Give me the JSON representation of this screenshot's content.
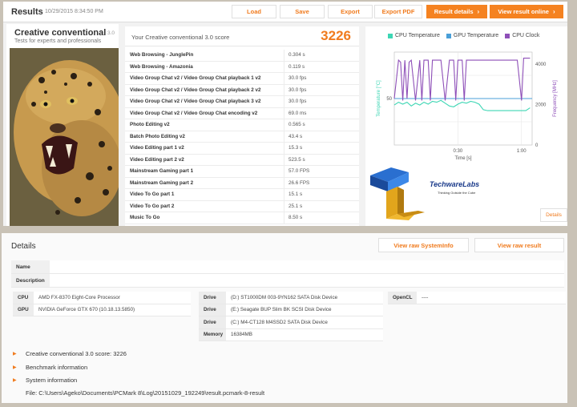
{
  "header": {
    "title": "Results",
    "date": "10/29/2015 8:34:50 PM",
    "buttons": {
      "load": "Load",
      "save": "Save",
      "export": "Export",
      "export_pdf": "Export PDF",
      "result_details": "Result details",
      "view_online": "View result online"
    }
  },
  "test": {
    "name": "Creative conventional",
    "version": "3.0",
    "subtitle": "Tests for experts and professionals"
  },
  "score": {
    "label": "Your Creative conventional 3.0 score",
    "value": "3226",
    "rows": [
      {
        "name": "Web Browsing - JunglePin",
        "value": "0.304 s"
      },
      {
        "name": "Web Browsing - Amazonia",
        "value": "0.119 s"
      },
      {
        "name": "Video Group Chat v2 / Video Group Chat playback 1 v2",
        "value": "30.0 fps"
      },
      {
        "name": "Video Group Chat v2 / Video Group Chat playback 2 v2",
        "value": "30.0 fps"
      },
      {
        "name": "Video Group Chat v2 / Video Group Chat playback 3 v2",
        "value": "30.0 fps"
      },
      {
        "name": "Video Group Chat v2 / Video Group Chat encoding v2",
        "value": "69.0 ms"
      },
      {
        "name": "Photo Editing v2",
        "value": "0.565 s"
      },
      {
        "name": "Batch Photo Editing v2",
        "value": "43.4 s"
      },
      {
        "name": "Video Editing part 1 v2",
        "value": "15.3 s"
      },
      {
        "name": "Video Editing part 2 v2",
        "value": "523.5 s"
      },
      {
        "name": "Mainstream Gaming part 1",
        "value": "57.0 FPS"
      },
      {
        "name": "Mainstream Gaming part 2",
        "value": "26.6 FPS"
      },
      {
        "name": "Video To Go part 1",
        "value": "15.1 s"
      },
      {
        "name": "Video To Go part 2",
        "value": "25.1 s"
      },
      {
        "name": "Music To Go",
        "value": "8.50 s"
      }
    ]
  },
  "chart_data": {
    "type": "line",
    "legend": [
      "CPU Temperature",
      "GPU Temperature",
      "CPU Clock"
    ],
    "colors": {
      "cpu_temp": "#3dd6b4",
      "gpu_temp": "#4a9fd8",
      "cpu_clock": "#8e4fb8"
    },
    "ylabel_left": "Temperature [°C]",
    "ylabel_right": "Frequency [MHz]",
    "xlabel": "Time [s]",
    "x_ticks": [
      "0:30",
      "1:00"
    ],
    "y_left_ticks": [
      "50"
    ],
    "y_right_ticks": [
      "4000",
      "2000",
      "0"
    ],
    "x_range": [
      0,
      65
    ],
    "y_left_range": [
      0,
      100
    ],
    "y_right_range": [
      0,
      4600
    ],
    "series": [
      {
        "name": "CPU Temperature",
        "axis": "left",
        "x": [
          0,
          2,
          4,
          6,
          8,
          10,
          12,
          14,
          16,
          18,
          20,
          22,
          24,
          26,
          28,
          30,
          32,
          34,
          36,
          38,
          40,
          42,
          44,
          46,
          48,
          50,
          52,
          54,
          56,
          58,
          60,
          62,
          64
        ],
        "y": [
          43,
          46,
          44,
          46,
          42,
          45,
          43,
          46,
          44,
          47,
          46,
          48,
          45,
          42,
          41,
          44,
          46,
          45,
          47,
          46,
          44,
          38,
          37,
          37,
          37,
          37,
          37,
          37,
          37,
          37,
          37,
          37,
          40
        ]
      },
      {
        "name": "GPU Temperature",
        "axis": "left",
        "x": [
          0,
          65
        ],
        "y": [
          50,
          50
        ]
      },
      {
        "name": "CPU Clock",
        "axis": "right",
        "x": [
          0,
          2,
          3,
          4,
          5,
          6,
          7,
          8,
          10,
          12,
          13,
          14,
          16,
          17,
          18,
          20,
          22,
          24,
          26,
          28,
          29,
          30,
          32,
          33,
          34,
          36,
          38,
          40,
          42,
          44,
          46,
          48,
          50,
          52,
          54,
          56,
          58,
          60,
          61,
          62,
          64
        ],
        "y": [
          2300,
          4200,
          4100,
          2200,
          4200,
          2300,
          4100,
          4200,
          2200,
          4200,
          2200,
          4200,
          4200,
          2200,
          4200,
          4200,
          4200,
          2200,
          4200,
          4200,
          2200,
          4200,
          4200,
          2200,
          4200,
          4200,
          4200,
          4200,
          4200,
          4200,
          4200,
          4200,
          4200,
          4200,
          4200,
          4200,
          4200,
          2200,
          4300,
          4300,
          4300
        ]
      }
    ]
  },
  "logo": {
    "brand": "TechwareLabs",
    "tagline": "Thinking Outside the Cube"
  },
  "chart_details_button": "Details",
  "details": {
    "title": "Details",
    "raw_systeminfo": "View raw SystemInfo",
    "raw_result": "View raw result",
    "name_label": "Name",
    "description_label": "Description",
    "cpu_label": "CPU",
    "cpu_value": "AMD FX-8370 Eight-Core Processor",
    "gpu_label": "GPU",
    "gpu_value": "NVIDIA GeForce GTX 670 (10.18.13.5850)",
    "drives": [
      {
        "label": "Drive",
        "value": "(D:) ST1000DM 003-9YN162 SATA Disk Device"
      },
      {
        "label": "Drive",
        "value": "(E:) Seagate BUP Slim BK SCSI Disk Device"
      },
      {
        "label": "Drive",
        "value": "(C:) M4-CT128 M4SSD2 SATA Disk Device"
      },
      {
        "label": "Memory",
        "value": "16384MB"
      }
    ],
    "opencl_label": "OpenCL",
    "opencl_value": "----",
    "expand_score": "Creative conventional 3.0 score: 3226",
    "expand_benchmark": "Benchmark information",
    "expand_system": "System information",
    "file": "File: C:\\Users\\Ageko\\Documents\\PCMark 8\\Log\\20151029_192249\\result.pcmark-8-result"
  }
}
